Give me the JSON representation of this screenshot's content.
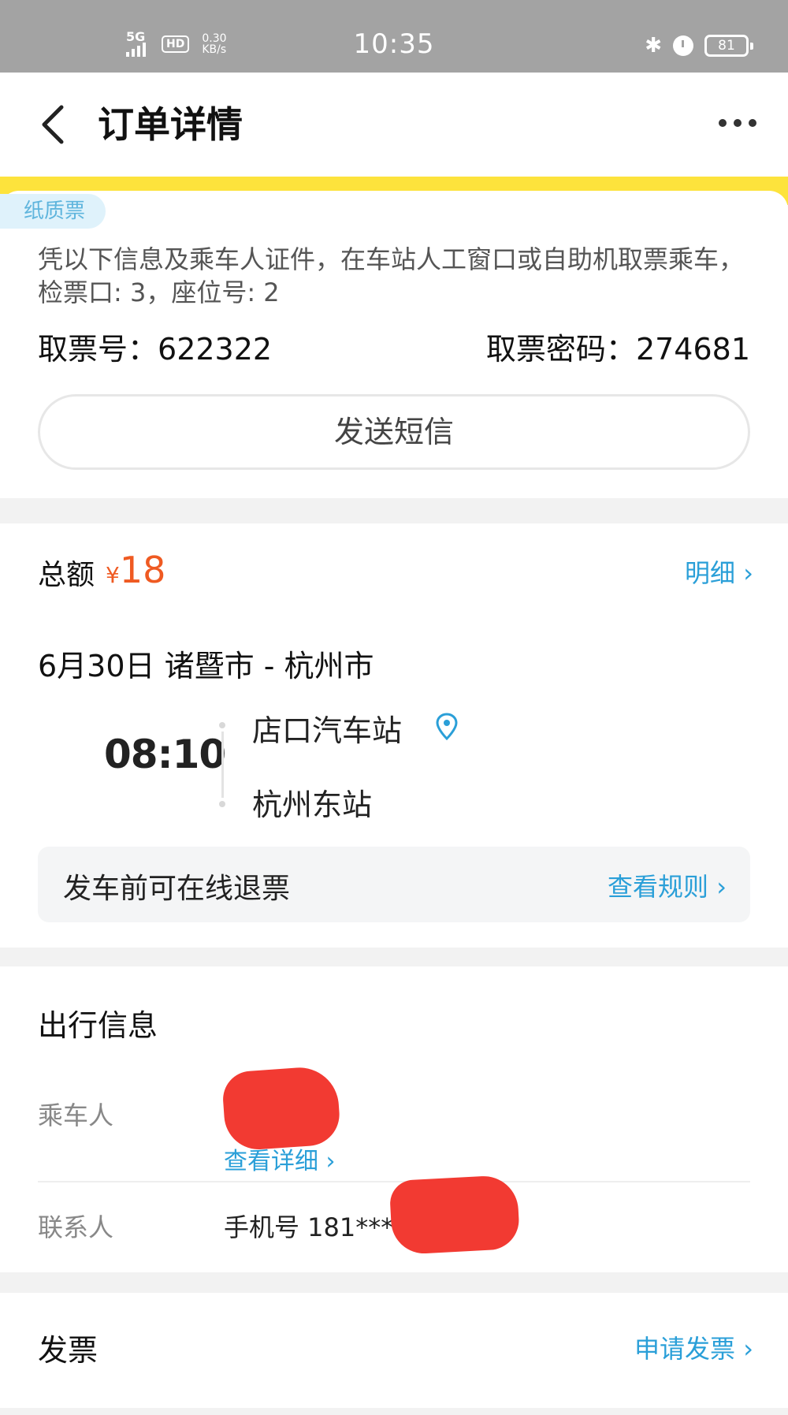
{
  "status_bar": {
    "network": "5G",
    "hd": "HD",
    "speed_value": "0.30",
    "speed_unit": "KB/s",
    "time": "10:35",
    "bluetooth_glyph": "✱",
    "battery": "81"
  },
  "header": {
    "title": "订单详情"
  },
  "ticket": {
    "tag": "纸质票",
    "description": "凭以下信息及乘车人证件，在车站人工窗口或自助机取票乘车，检票口: 3，座位号: 2",
    "pickup_no_label": "取票号：",
    "pickup_no": "622322",
    "pickup_pwd_label": "取票密码：",
    "pickup_pwd": "274681",
    "sms_button": "发送短信"
  },
  "trip": {
    "total_label": "总额",
    "currency": "¥",
    "total_amount": "18",
    "detail_link": "明细 ›",
    "route": "6月30日 诸暨市 - 杭州市",
    "departure_time": "08:10",
    "from_station": "店口汽车站",
    "to_station": "杭州东站",
    "refund_text": "发车前可在线退票",
    "rules_link": "查看规则 ›"
  },
  "travel": {
    "title": "出行信息",
    "passenger_label": "乘车人",
    "passenger_detail_link": "查看详细 ›",
    "contact_label": "联系人",
    "contact_value": "手机号 181***"
  },
  "invoice": {
    "title": "发票",
    "link": "申请发票 ›"
  },
  "colors": {
    "accent_blue": "#2a9fd8",
    "price_orange": "#ef5a22",
    "header_yellow": "#fde33c",
    "redaction_red": "#f23a32"
  }
}
